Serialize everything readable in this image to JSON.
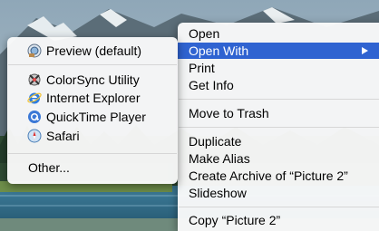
{
  "context_menu": {
    "items": [
      {
        "label": "Open"
      },
      {
        "label": "Open With",
        "highlighted": true,
        "has_submenu": true
      },
      {
        "label": "Print"
      },
      {
        "label": "Get Info"
      },
      {
        "label": "Move to Trash"
      },
      {
        "label": "Duplicate"
      },
      {
        "label": "Make Alias"
      },
      {
        "label": "Create Archive of “Picture 2”"
      },
      {
        "label": "Slideshow"
      },
      {
        "label": "Copy “Picture 2”"
      }
    ]
  },
  "open_with_submenu": {
    "items": [
      {
        "label": "Preview (default)",
        "icon": "preview-icon"
      },
      {
        "label": "ColorSync Utility",
        "icon": "colorsync-icon"
      },
      {
        "label": "Internet Explorer",
        "icon": "internet-explorer-icon"
      },
      {
        "label": "QuickTime Player",
        "icon": "quicktime-icon"
      },
      {
        "label": "Safari",
        "icon": "safari-icon"
      },
      {
        "label": "Other..."
      }
    ]
  },
  "colors": {
    "highlight": "#2f63d1",
    "menu_background": "#fafafa",
    "separator": "#d6d6d6"
  }
}
